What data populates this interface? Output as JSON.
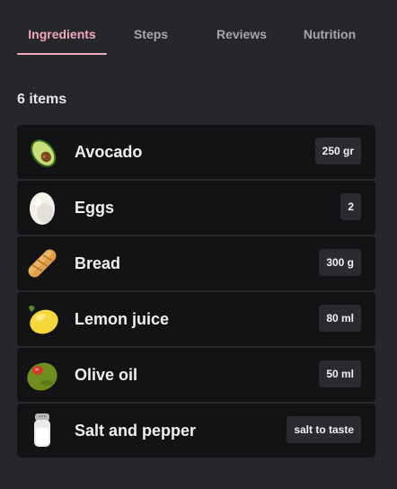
{
  "tabs": [
    {
      "label": "Ingredients",
      "active": true
    },
    {
      "label": "Steps",
      "active": false
    },
    {
      "label": "Reviews",
      "active": false
    },
    {
      "label": "Nutrition",
      "active": false
    }
  ],
  "colors": {
    "background": "#26272b",
    "row_background": "#131315",
    "accent": "#f2a9bd"
  },
  "item_count_label": "6 items",
  "ingredients": [
    {
      "name": "Avocado",
      "quantity": "250 gr",
      "icon": "avocado-icon"
    },
    {
      "name": "Eggs",
      "quantity": "2",
      "icon": "egg-icon"
    },
    {
      "name": "Bread",
      "quantity": "300 g",
      "icon": "bread-icon"
    },
    {
      "name": "Lemon juice",
      "quantity": "80 ml",
      "icon": "lemon-icon"
    },
    {
      "name": "Olive oil",
      "quantity": "50 ml",
      "icon": "olive-icon"
    },
    {
      "name": "Salt and pepper",
      "quantity": "salt to taste",
      "icon": "salt-shaker-icon"
    }
  ]
}
